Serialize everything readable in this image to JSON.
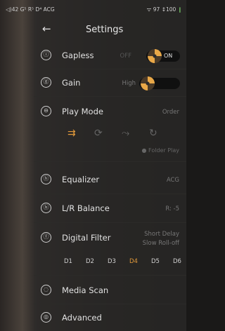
{
  "status": {
    "left": "◁)42 G⁵ R⁵ D⁴ ACG",
    "right_wifi": "ᯤ 97",
    "right_batt": "↕100",
    "batt_icon": "❙"
  },
  "header": {
    "back": "←",
    "title": "Settings"
  },
  "gapless": {
    "label": "Gapless",
    "off": "OFF",
    "on": "ON",
    "icon": "ⓘ"
  },
  "gain": {
    "label": "Gain",
    "value": "High",
    "icon": "ⓖ"
  },
  "play_mode": {
    "label": "Play Mode",
    "value": "Order",
    "icon": "⊖",
    "modes": [
      "⇉",
      "⟳",
      "⤳",
      "↻"
    ],
    "active_index": 0,
    "folder_play": "● Folder Play"
  },
  "equalizer": {
    "label": "Equalizer",
    "value": "ACG",
    "icon": "ⓗ"
  },
  "balance": {
    "label": "L/R Balance",
    "value": "R: -5",
    "icon": "ⓑ"
  },
  "digital_filter": {
    "label": "Digital Filter",
    "value_line1": "Short Delay",
    "value_line2": "Slow Roll-off",
    "icon": "ⓕ",
    "options": [
      "D1",
      "D2",
      "D3",
      "D4",
      "D5",
      "D6"
    ],
    "active_index": 3
  },
  "media_scan": {
    "label": "Media Scan",
    "icon": "◌"
  },
  "advanced": {
    "label": "Advanced",
    "icon": "◎"
  },
  "colors": {
    "accent": "#e39a3a",
    "panel": "#302e2c"
  }
}
